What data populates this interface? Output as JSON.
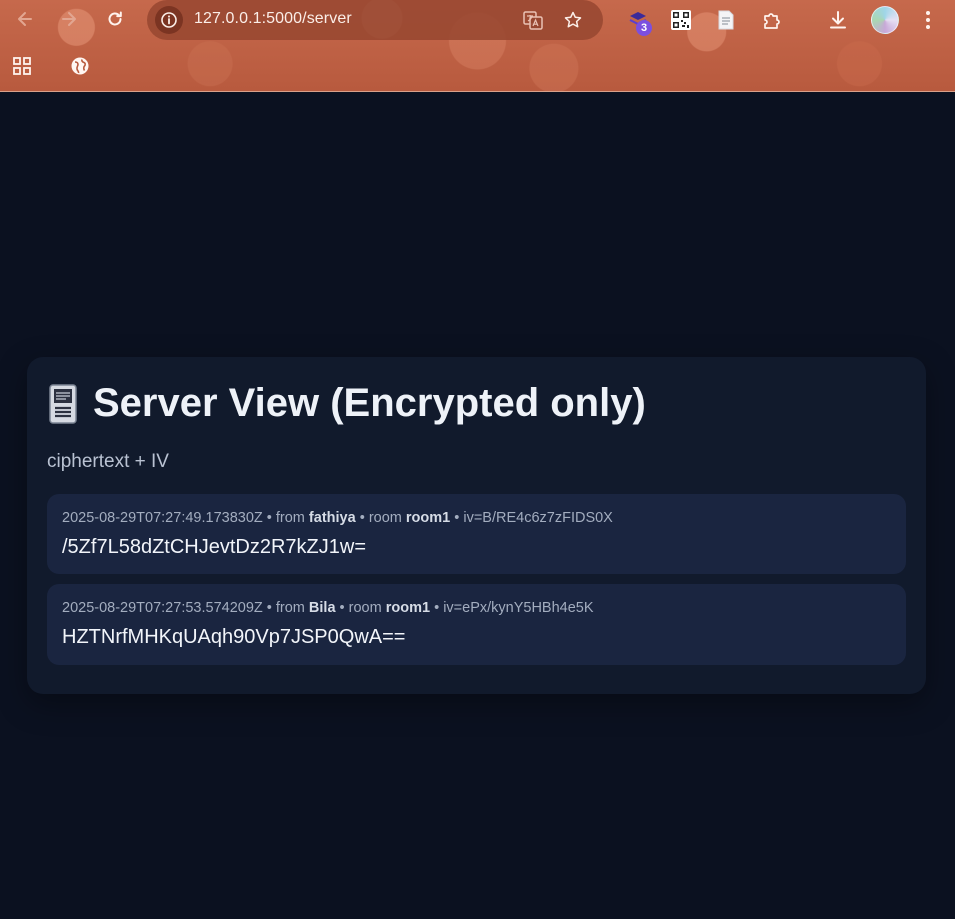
{
  "browser": {
    "url": "127.0.0.1:5000/server",
    "extension_badge_count": "3",
    "theme_color": "#c6694c"
  },
  "icons": {
    "back": "arrow-left-icon",
    "forward": "arrow-right-icon",
    "reload": "reload-icon",
    "site_info": "info-icon",
    "translate": "translate-icon",
    "bookmark": "star-icon",
    "extension": "stack-icon",
    "qr": "qr-code-icon",
    "reader": "document-icon",
    "extensions": "puzzle-icon",
    "downloads": "download-icon",
    "profile": "avatar",
    "menu": "kebab-menu-icon",
    "apps": "apps-grid-icon",
    "globe": "globe-icon",
    "page_title": "pager-icon"
  },
  "page": {
    "title": "Server View (Encrypted only)",
    "subtitle": "ciphertext + IV",
    "messages": [
      {
        "timestamp": "2025-08-29T07:27:49.173830Z",
        "from_label": "from",
        "sender": "fathiya",
        "room_label": "room",
        "room": "room1",
        "iv": "iv=B/RE4c6z7zFIDS0X",
        "ciphertext": "/5Zf7L58dZtCHJevtDz2R7kZJ1w="
      },
      {
        "timestamp": "2025-08-29T07:27:53.574209Z",
        "from_label": "from",
        "sender": "Bila",
        "room_label": "room",
        "room": "room1",
        "iv": "iv=ePx/kynY5HBh4e5K",
        "ciphertext": "HZTNrfMHKqUAqh90Vp7JSP0QwA=="
      }
    ],
    "colors": {
      "background": "#0b1120",
      "card": "#111a2c",
      "message": "#1a2540"
    }
  }
}
